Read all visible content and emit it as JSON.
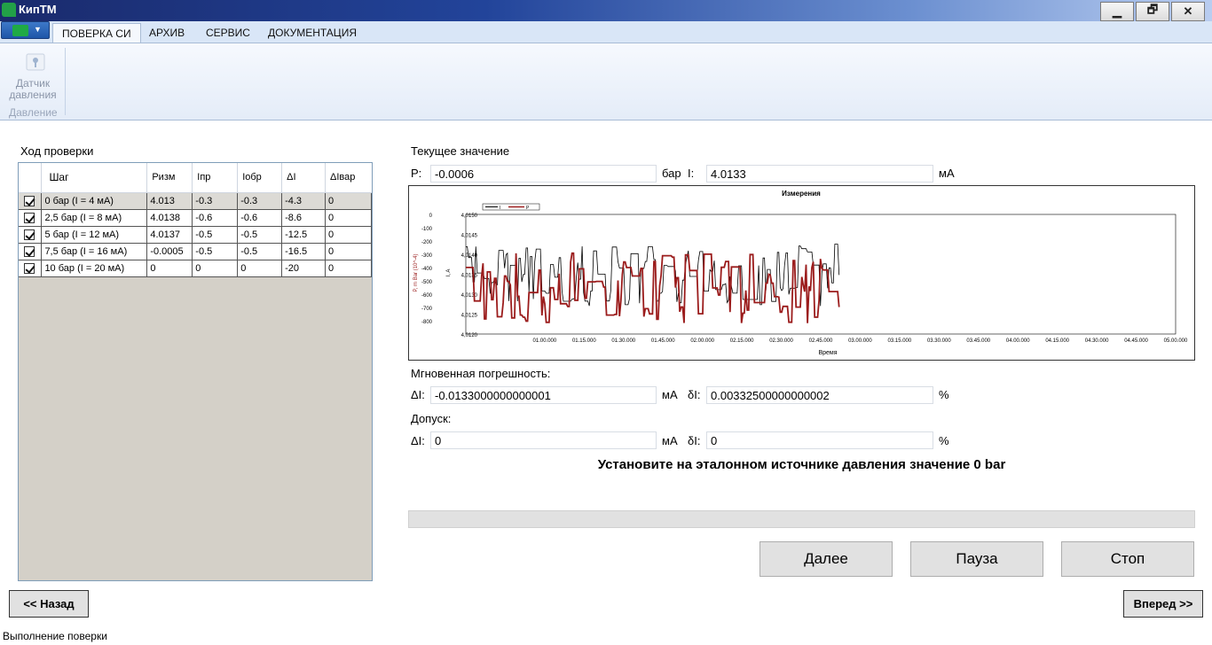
{
  "window": {
    "title": "КипТМ",
    "min_label": "▁",
    "restore_label": "🗗",
    "close_label": "✕"
  },
  "ribbon": {
    "tabs": [
      "ПОВЕРКА СИ",
      "АРХИВ",
      "СЕРВИС",
      "ДОКУМЕНТАЦИЯ"
    ],
    "button_line1": "Датчик",
    "button_line2": "давления",
    "group_label": "Давление"
  },
  "progress_panel": {
    "title": "Ход проверки",
    "columns": [
      "Шаг",
      "Ризм",
      "Iпр",
      "Iобр",
      "ΔI",
      "ΔIвар"
    ],
    "rows": [
      {
        "checked": true,
        "step": "0 бар (I = 4 мА)",
        "p": "4.013",
        "ipr": "-0.3",
        "iobr": "-0.3",
        "di": "-4.3",
        "divar": "0"
      },
      {
        "checked": true,
        "step": "2,5 бар (I = 8 мА)",
        "p": "4.0138",
        "ipr": "-0.6",
        "iobr": "-0.6",
        "di": "-8.6",
        "divar": "0"
      },
      {
        "checked": true,
        "step": "5 бар (I = 12 мА)",
        "p": "4.0137",
        "ipr": "-0.5",
        "iobr": "-0.5",
        "di": "-12.5",
        "divar": "0"
      },
      {
        "checked": true,
        "step": "7,5 бар (I = 16 мА)",
        "p": "-0.0005",
        "ipr": "-0.5",
        "iobr": "-0.5",
        "di": "-16.5",
        "divar": "0"
      },
      {
        "checked": true,
        "step": "10 бар (I = 20 мА)",
        "p": "0",
        "ipr": "0",
        "iobr": "0",
        "di": "-20",
        "divar": "0"
      }
    ]
  },
  "current": {
    "title": "Текущее значение",
    "p_label": "P:",
    "p_value": "-0.0006",
    "p_unit": "бар",
    "i_label": "I:",
    "i_value": "4.0133",
    "i_unit": "мА"
  },
  "chart_data": {
    "type": "line",
    "title": "Измерения",
    "xlabel": "Время",
    "ylabel_left_outer": "P, m Bar (10^-4)",
    "ylabel_left_inner": "I, A",
    "legend": [
      "I",
      "P"
    ],
    "legend_placement": "top-left",
    "series_colors": {
      "I": "#000000",
      "P": "#9b1c1c"
    },
    "y_outer_ticks": [
      "0",
      "-100",
      "-200",
      "-300",
      "-400",
      "-500",
      "-600",
      "-700",
      "-800"
    ],
    "y_inner_ticks": [
      "4,0150",
      "4,0145",
      "4,0140",
      "4,0135",
      "4,0130",
      "4,0125",
      "4,0120"
    ],
    "x_ticks": [
      "01.00.000",
      "01.15.000",
      "01.30.000",
      "01.45.000",
      "02.00.000",
      "02.15.000",
      "02.30.000",
      "02.45.000",
      "03.00.000",
      "03.15.000",
      "03.30.000",
      "03.45.000",
      "04.00.000",
      "04.15.000",
      "04.30.000",
      "04.45.000",
      "05.00.000"
    ],
    "x_range_seconds": [
      30,
      300
    ],
    "data_end_seconds": 172,
    "series_I_range": [
      4.0127,
      4.0145
    ],
    "series_P_range": [
      -820,
      0
    ]
  },
  "error": {
    "title": "Мгновенная погрешность:",
    "di_label": "ΔI:",
    "di_value": "-0.0133000000000001",
    "di_unit": "мА",
    "dl_label": "δI:",
    "dl_value": "0.00332500000000002",
    "dl_unit": "%"
  },
  "tolerance": {
    "title": "Допуск:",
    "di_label": "ΔI:",
    "di_value": "0",
    "di_unit": "мА",
    "dl_label": "δI:",
    "dl_value": "0",
    "dl_unit": "%"
  },
  "instruction": "Установите на эталонном источнике давления значение 0 bar",
  "buttons": {
    "next": "Далее",
    "pause": "Пауза",
    "stop": "Стоп",
    "back": "<< Назад",
    "forward": "Вперед >>"
  },
  "status": "Выполнение поверки"
}
